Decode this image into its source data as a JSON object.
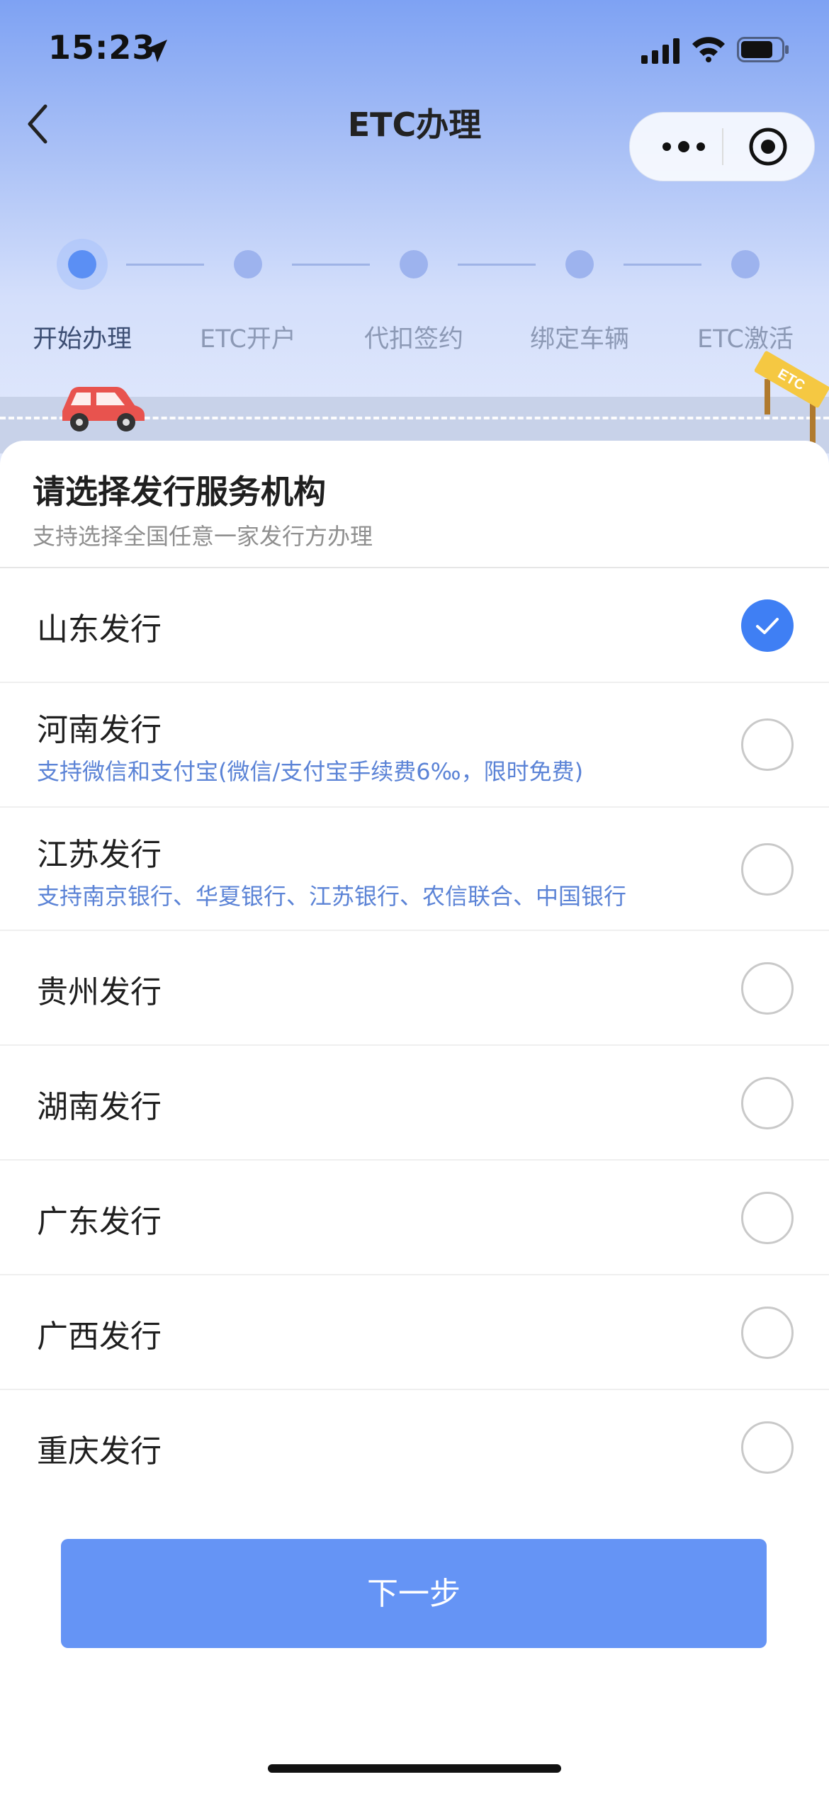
{
  "status_bar": {
    "time": "15:23"
  },
  "nav": {
    "title": "ETC办理"
  },
  "steps": [
    {
      "label": "开始办理",
      "active": true
    },
    {
      "label": "ETC开户",
      "active": false
    },
    {
      "label": "代扣签约",
      "active": false
    },
    {
      "label": "绑定车辆",
      "active": false
    },
    {
      "label": "ETC激活",
      "active": false
    }
  ],
  "sign_text": "ETC",
  "panel": {
    "title": "请选择发行服务机构",
    "subtitle": "支持选择全国任意一家发行方办理"
  },
  "options": [
    {
      "name": "山东发行",
      "note": "",
      "selected": true
    },
    {
      "name": "河南发行",
      "note": "支持微信和支付宝(微信/支付宝手续费6‰，限时免费)",
      "selected": false
    },
    {
      "name": "江苏发行",
      "note": "支持南京银行、华夏银行、江苏银行、农信联合、中国银行",
      "selected": false
    },
    {
      "name": "贵州发行",
      "note": "",
      "selected": false
    },
    {
      "name": "湖南发行",
      "note": "",
      "selected": false
    },
    {
      "name": "广东发行",
      "note": "",
      "selected": false
    },
    {
      "name": "广西发行",
      "note": "",
      "selected": false
    },
    {
      "name": "重庆发行",
      "note": "",
      "selected": false
    }
  ],
  "next_button": "下一步",
  "colors": {
    "accent": "#3f7ff4",
    "button": "#6594f5",
    "note_text": "#5b83d6"
  }
}
